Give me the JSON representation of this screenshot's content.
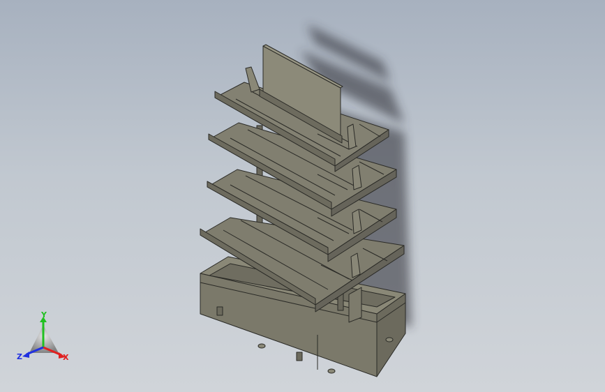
{
  "window": {
    "title": ""
  },
  "viewport": {
    "background_top": "#a7b1bf",
    "background_bottom": "#d0d4d9",
    "model_color": "#7d7b6c",
    "model_edge_color": "#2a2a26"
  },
  "triad": {
    "x_label": "X",
    "y_label": "Y",
    "z_label": "Z",
    "x_color": "#e02020",
    "y_color": "#20c020",
    "z_color": "#2030e0"
  }
}
